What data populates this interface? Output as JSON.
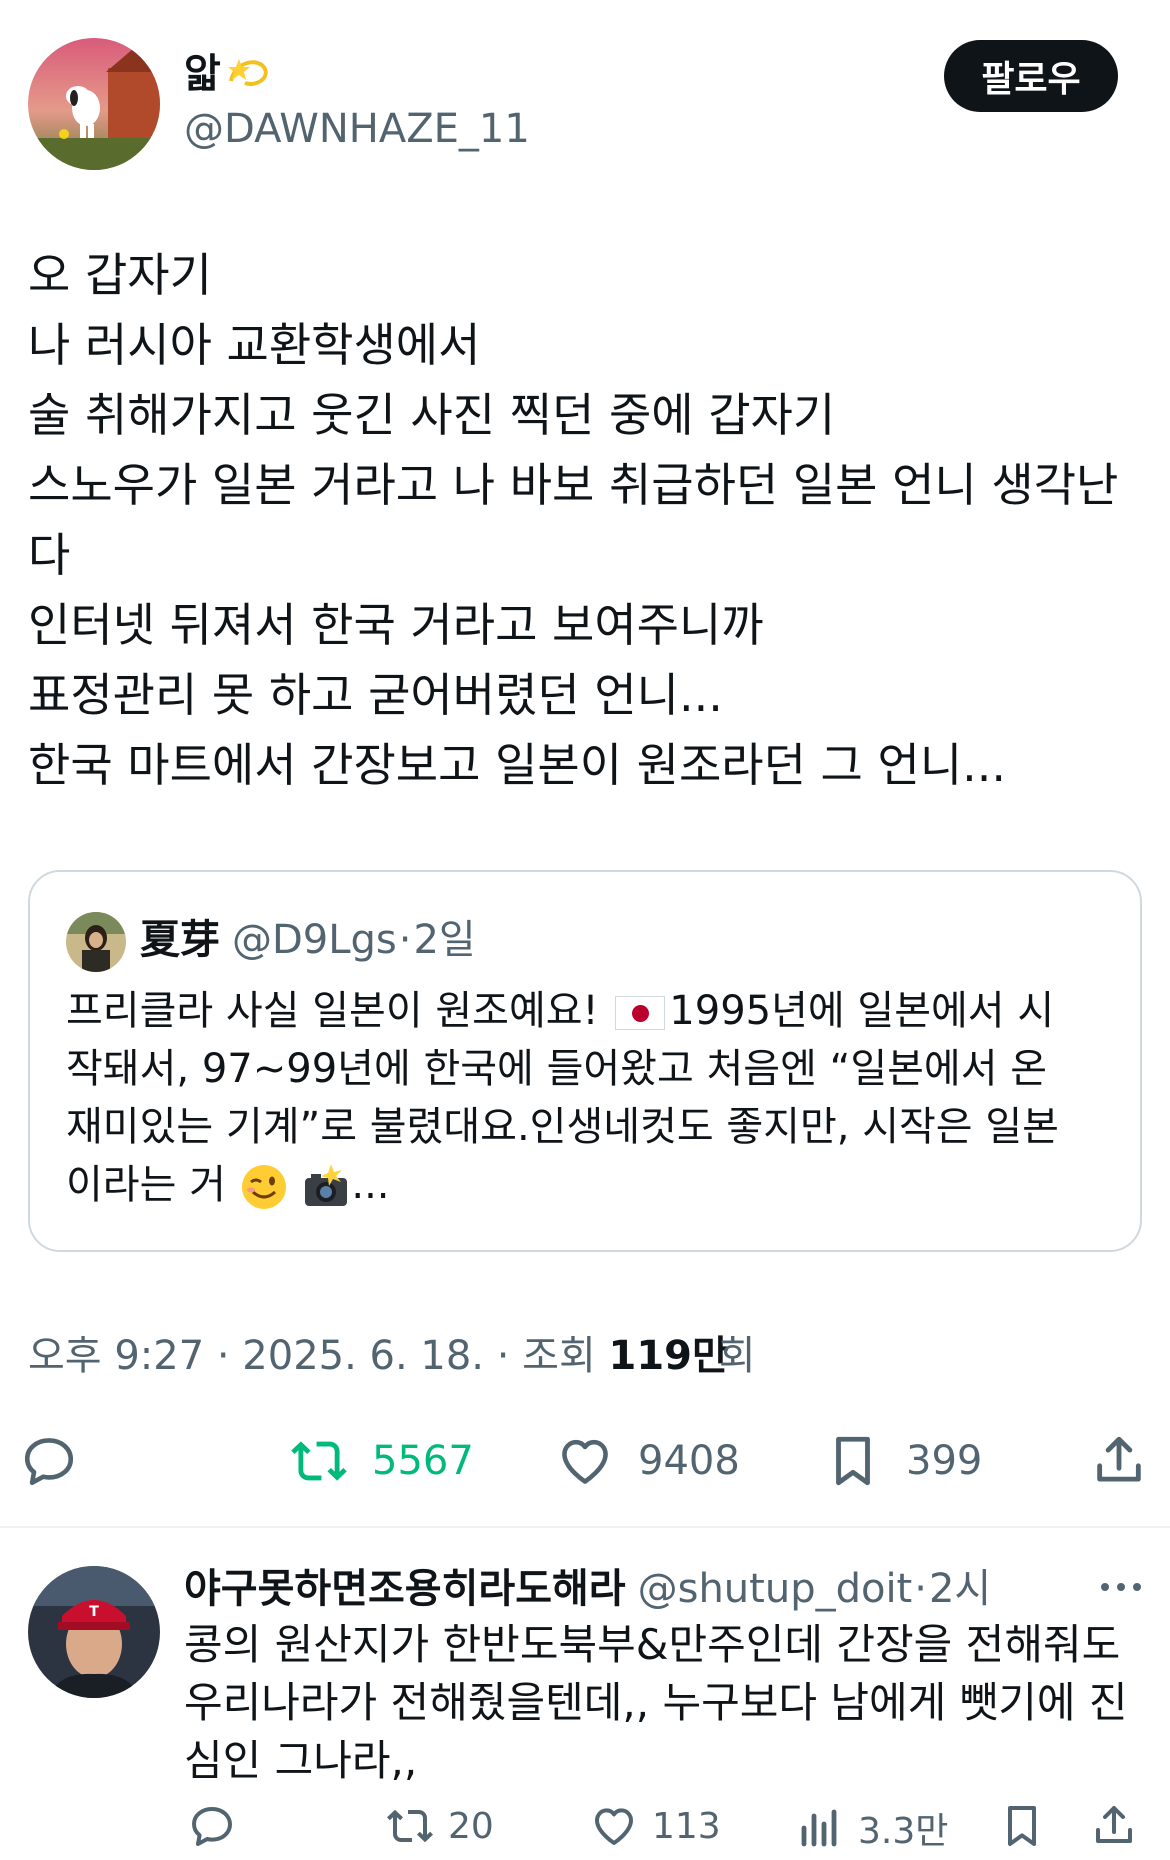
{
  "author": {
    "name": "앏",
    "name_emoji": "dizzy-star-emoji",
    "handle": "@DAWNHAZE_11",
    "follow_label": "팔로우"
  },
  "tweet": {
    "lines": [
      "오 갑자기",
      "나 러시아 교환학생에서",
      "술 취해가지고 웃긴 사진 찍던 중에 갑자기",
      "스노우가 일본 거라고 나 바보 취급하던 일본 언니 생각난",
      "다",
      "인터넷 뒤져서 한국 거라고 보여주니까",
      "표정관리 못 하고 굳어버렸던 언니...",
      "한국 마트에서 간장보고 일본이 원조라던 그 언니..."
    ]
  },
  "quote": {
    "name": "夏芽",
    "handle": "@D9Lgs",
    "time": "2일",
    "line1_a": "프리클라 사실 일본이 원조예요! ",
    "line1_b": "1995년에 일본에서 시",
    "line2": "작돼서, 97~99년에 한국에 들어왔고 처음엔 “일본에서 온",
    "line3": "재미있는 기계”로 불렸대요.인생네컷도 좋지만, 시작은 일본",
    "line4_a": "이라는 거 ",
    "line4_b": "...",
    "emojis": [
      "japan-flag-emoji",
      "winking-face-emoji",
      "camera-with-flash-emoji"
    ]
  },
  "meta": {
    "time": "오후 9:27",
    "date": "2025. 6. 18.",
    "views_label": "조회",
    "views_value": "119만",
    "views_suffix": "회",
    "sep": "·"
  },
  "actions": {
    "reply_count": "",
    "retweet_count": "5567",
    "like_count": "9408",
    "bookmark_count": "399",
    "retweet_color": "#00ba7c"
  },
  "reply": {
    "name": "야구못하면조용히라도해라",
    "handle": "@shutup_doit",
    "time": "2시",
    "lines": [
      "콩의 원산지가 한반도북부&만주인데 간장을 전해줘도",
      "우리나라가 전해줬을텐데,, 누구보다 남에게 뺏기에 진",
      "심인 그나라,,"
    ],
    "retweet_count": "20",
    "like_count": "113",
    "views_count": "3.3만"
  }
}
